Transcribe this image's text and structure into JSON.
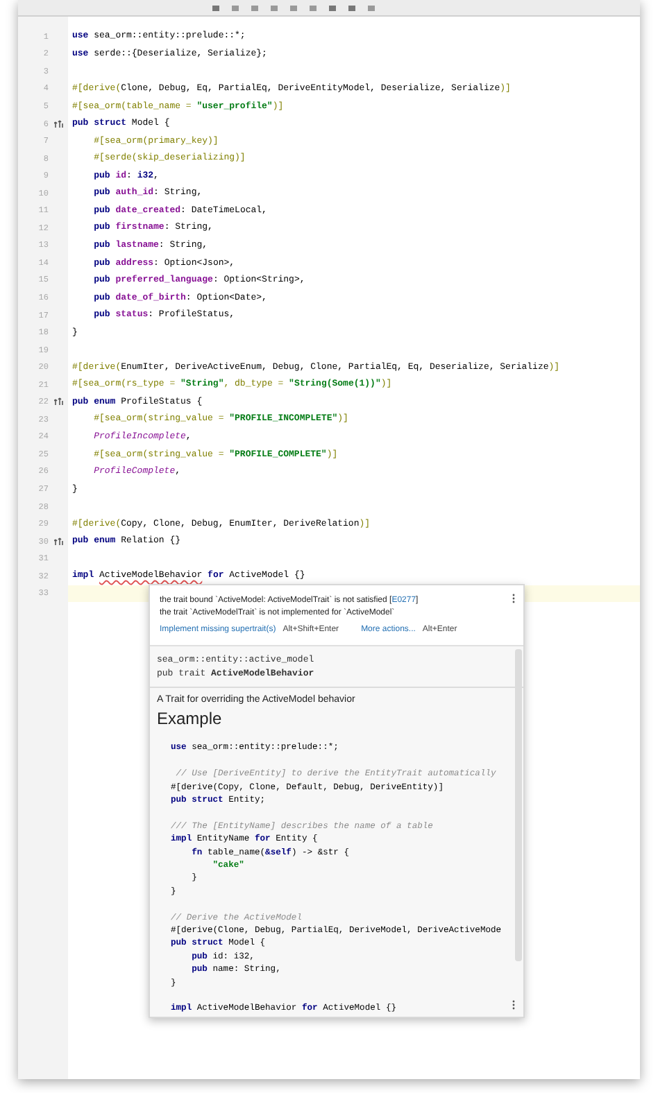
{
  "editor": {
    "lines": [
      {
        "number": "1",
        "tokens": [
          {
            "text": "use",
            "kind": "kw"
          },
          {
            "text": " sea_orm::entity::prelude::*;",
            "kind": "plain"
          }
        ]
      },
      {
        "number": "2",
        "tokens": [
          {
            "text": "use",
            "kind": "kw"
          },
          {
            "text": " serde::{Deserialize, Serialize};",
            "kind": "plain"
          }
        ]
      },
      {
        "number": "3"
      },
      {
        "number": "4",
        "tokens": [
          {
            "text": "#[derive(",
            "kind": "attr"
          },
          {
            "text": "Clone, Debug, Eq, PartialEq, DeriveEntityModel, Deserialize, Serialize",
            "kind": "plain"
          },
          {
            "text": ")]",
            "kind": "attr"
          }
        ]
      },
      {
        "number": "5",
        "tokens": [
          {
            "text": "#[sea_orm(table_name = ",
            "kind": "attr"
          },
          {
            "text": "\"user_profile\"",
            "kind": "string"
          },
          {
            "text": ")]",
            "kind": "attr"
          }
        ]
      },
      {
        "number": "6",
        "gutter_icon": true,
        "tokens": [
          {
            "text": "pub struct",
            "kind": "kw"
          },
          {
            "text": " Model {",
            "kind": "plain"
          }
        ]
      },
      {
        "number": "7",
        "tokens": [
          {
            "text": "    #[sea_orm(primary_key)]",
            "kind": "attr"
          }
        ]
      },
      {
        "number": "8",
        "tokens": [
          {
            "text": "    #[serde(skip_deserializing)]",
            "kind": "attr"
          }
        ]
      },
      {
        "number": "9",
        "tokens": [
          {
            "text": "    pub",
            "kind": "kw"
          },
          {
            "text": " id",
            "kind": "field"
          },
          {
            "text": ": ",
            "kind": "plain"
          },
          {
            "text": "i32",
            "kind": "kw"
          },
          {
            "text": ",",
            "kind": "plain"
          }
        ]
      },
      {
        "number": "10",
        "tokens": [
          {
            "text": "    pub",
            "kind": "kw"
          },
          {
            "text": " auth_id",
            "kind": "field"
          },
          {
            "text": ": String,",
            "kind": "plain"
          }
        ]
      },
      {
        "number": "11",
        "tokens": [
          {
            "text": "    pub",
            "kind": "kw"
          },
          {
            "text": " date_created",
            "kind": "field"
          },
          {
            "text": ": DateTimeLocal,",
            "kind": "plain"
          }
        ]
      },
      {
        "number": "12",
        "tokens": [
          {
            "text": "    pub",
            "kind": "kw"
          },
          {
            "text": " firstname",
            "kind": "field"
          },
          {
            "text": ": String,",
            "kind": "plain"
          }
        ]
      },
      {
        "number": "13",
        "tokens": [
          {
            "text": "    pub",
            "kind": "kw"
          },
          {
            "text": " lastname",
            "kind": "field"
          },
          {
            "text": ": String,",
            "kind": "plain"
          }
        ]
      },
      {
        "number": "14",
        "tokens": [
          {
            "text": "    pub",
            "kind": "kw"
          },
          {
            "text": " address",
            "kind": "field"
          },
          {
            "text": ": Option<Json>,",
            "kind": "plain"
          }
        ]
      },
      {
        "number": "15",
        "tokens": [
          {
            "text": "    pub",
            "kind": "kw"
          },
          {
            "text": " preferred_language",
            "kind": "field"
          },
          {
            "text": ": Option<String>,",
            "kind": "plain"
          }
        ]
      },
      {
        "number": "16",
        "tokens": [
          {
            "text": "    pub",
            "kind": "kw"
          },
          {
            "text": " date_of_birth",
            "kind": "field"
          },
          {
            "text": ": Option<Date>,",
            "kind": "plain"
          }
        ]
      },
      {
        "number": "17",
        "tokens": [
          {
            "text": "    pub",
            "kind": "kw"
          },
          {
            "text": " status",
            "kind": "field"
          },
          {
            "text": ": ProfileStatus,",
            "kind": "plain"
          }
        ]
      },
      {
        "number": "18",
        "tokens": [
          {
            "text": "}",
            "kind": "plain"
          }
        ]
      },
      {
        "number": "19"
      },
      {
        "number": "20",
        "tokens": [
          {
            "text": "#[derive(",
            "kind": "attr"
          },
          {
            "text": "EnumIter, DeriveActiveEnum, Debug, Clone, PartialEq, Eq, Deserialize, Serialize",
            "kind": "plain"
          },
          {
            "text": ")]",
            "kind": "attr"
          }
        ]
      },
      {
        "number": "21",
        "tokens": [
          {
            "text": "#[sea_orm(rs_type = ",
            "kind": "attr"
          },
          {
            "text": "\"String\"",
            "kind": "string"
          },
          {
            "text": ", db_type = ",
            "kind": "attr"
          },
          {
            "text": "\"String(Some(1))\"",
            "kind": "string"
          },
          {
            "text": ")]",
            "kind": "attr"
          }
        ]
      },
      {
        "number": "22",
        "gutter_icon": true,
        "tokens": [
          {
            "text": "pub enum",
            "kind": "kw"
          },
          {
            "text": " ProfileStatus {",
            "kind": "plain"
          }
        ]
      },
      {
        "number": "23",
        "tokens": [
          {
            "text": "    #[sea_orm(string_value = ",
            "kind": "attr"
          },
          {
            "text": "\"PROFILE_INCOMPLETE\"",
            "kind": "string"
          },
          {
            "text": ")]",
            "kind": "attr"
          }
        ]
      },
      {
        "number": "24",
        "tokens": [
          {
            "text": "    ProfileIncomplete",
            "kind": "variant"
          },
          {
            "text": ",",
            "kind": "plain"
          }
        ]
      },
      {
        "number": "25",
        "tokens": [
          {
            "text": "    #[sea_orm(string_value = ",
            "kind": "attr"
          },
          {
            "text": "\"PROFILE_COMPLETE\"",
            "kind": "string"
          },
          {
            "text": ")]",
            "kind": "attr"
          }
        ]
      },
      {
        "number": "26",
        "tokens": [
          {
            "text": "    ProfileComplete",
            "kind": "variant"
          },
          {
            "text": ",",
            "kind": "plain"
          }
        ]
      },
      {
        "number": "27",
        "tokens": [
          {
            "text": "}",
            "kind": "plain"
          }
        ]
      },
      {
        "number": "28"
      },
      {
        "number": "29",
        "tokens": [
          {
            "text": "#[derive(",
            "kind": "attr"
          },
          {
            "text": "Copy, Clone, Debug, EnumIter, DeriveRelation",
            "kind": "plain"
          },
          {
            "text": ")]",
            "kind": "attr"
          }
        ]
      },
      {
        "number": "30",
        "gutter_icon": true,
        "tokens": [
          {
            "text": "pub enum",
            "kind": "kw"
          },
          {
            "text": " Relation {}",
            "kind": "plain"
          }
        ]
      },
      {
        "number": "31"
      },
      {
        "number": "32",
        "tokens": [
          {
            "text": "impl ",
            "kind": "kw"
          },
          {
            "text": "ActiveModelBehavior",
            "kind": "error"
          },
          {
            "text": " for",
            "kind": "kw"
          },
          {
            "text": " ActiveModel {}",
            "kind": "plain"
          }
        ]
      },
      {
        "number": "33",
        "current": true
      }
    ]
  },
  "popup": {
    "error_lines": [
      {
        "text": "the trait bound `ActiveModel: ActiveModelTrait` is not satisfied [",
        "link": "E0277",
        "after": "]"
      },
      {
        "text": "the trait `ActiveModelTrait` is not implemented for `ActiveModel`"
      }
    ],
    "actions": [
      {
        "label": "Implement missing supertrait(s)",
        "shortcut": "Alt+Shift+Enter"
      },
      {
        "label": "More actions...",
        "shortcut": "Alt+Enter"
      }
    ],
    "doc": {
      "path": "sea_orm::entity::active_model",
      "signature": "pub trait **ActiveModelBehavior**",
      "description": "A Trait for overriding the ActiveModel behavior",
      "heading": "Example",
      "code": [
        {
          "tokens": [
            {
              "text": "use",
              "kind": "kw"
            },
            {
              "text": " sea_orm::entity::prelude::*;",
              "kind": "plain"
            }
          ]
        },
        {
          "gap_before": true,
          "tokens": [
            {
              "text": " // Use [DeriveEntity] to derive the EntityTrait automatically",
              "kind": "comment"
            }
          ]
        },
        {
          "tokens": [
            {
              "text": "#[derive(Copy, Clone, Default, Debug, DeriveEntity)]",
              "kind": "plain"
            }
          ]
        },
        {
          "tokens": [
            {
              "text": "pub struct",
              "kind": "kw"
            },
            {
              "text": " Entity;",
              "kind": "plain"
            }
          ]
        },
        {
          "gap_before": true,
          "tokens": [
            {
              "text": "/// The [EntityName] describes the name of a table",
              "kind": "comment"
            }
          ]
        },
        {
          "tokens": [
            {
              "text": "impl",
              "kind": "kw"
            },
            {
              "text": " EntityName ",
              "kind": "plain"
            },
            {
              "text": "for",
              "kind": "kw"
            },
            {
              "text": " Entity {",
              "kind": "plain"
            }
          ]
        },
        {
          "tokens": [
            {
              "text": "    fn",
              "kind": "kw"
            },
            {
              "text": " table_name(",
              "kind": "plain"
            },
            {
              "text": "&self",
              "kind": "kw"
            },
            {
              "text": ") -> &str {",
              "kind": "plain"
            }
          ]
        },
        {
          "tokens": [
            {
              "text": "        \"cake\"",
              "kind": "string"
            }
          ]
        },
        {
          "tokens": [
            {
              "text": "    }",
              "kind": "plain"
            }
          ]
        },
        {
          "tokens": [
            {
              "text": "}",
              "kind": "plain"
            }
          ]
        },
        {
          "gap_before": true,
          "tokens": [
            {
              "text": "// Derive the ActiveModel",
              "kind": "comment"
            }
          ]
        },
        {
          "tokens": [
            {
              "text": "#[derive(Clone, Debug, PartialEq, DeriveModel, DeriveActiveMode",
              "kind": "plain"
            }
          ]
        },
        {
          "tokens": [
            {
              "text": "pub struct",
              "kind": "kw"
            },
            {
              "text": " Model {",
              "kind": "plain"
            }
          ]
        },
        {
          "tokens": [
            {
              "text": "    pub",
              "kind": "kw"
            },
            {
              "text": " id: i32,",
              "kind": "plain"
            }
          ]
        },
        {
          "tokens": [
            {
              "text": "    pub",
              "kind": "kw"
            },
            {
              "text": " name: String,",
              "kind": "plain"
            }
          ]
        },
        {
          "tokens": [
            {
              "text": "}",
              "kind": "plain"
            }
          ]
        },
        {
          "gap_before": true,
          "tokens": [
            {
              "text": "impl",
              "kind": "kw"
            },
            {
              "text": " ActiveModelBehavior ",
              "kind": "plain"
            },
            {
              "text": "for",
              "kind": "kw"
            },
            {
              "text": " ActiveModel {}",
              "kind": "plain"
            }
          ]
        }
      ]
    }
  }
}
